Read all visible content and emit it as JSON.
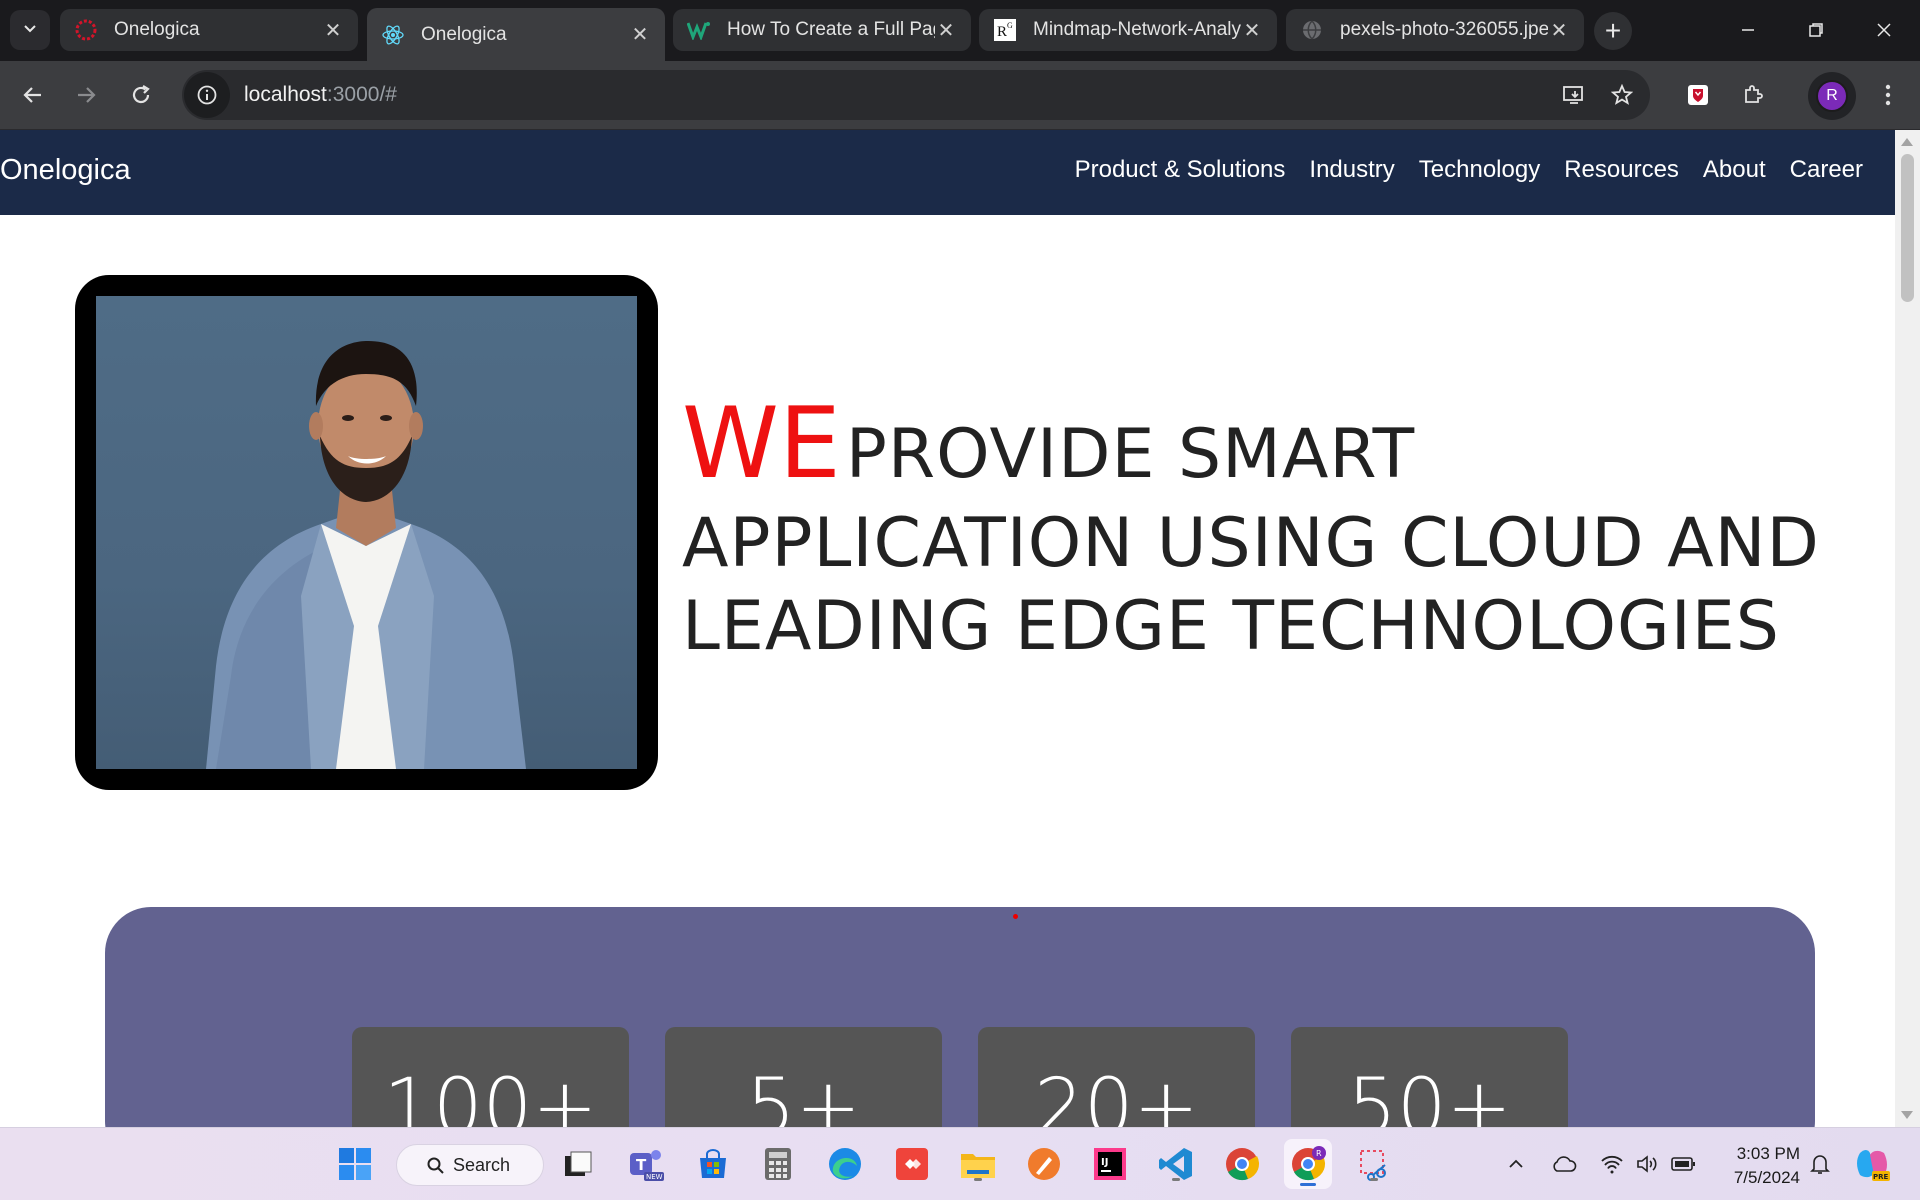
{
  "browser": {
    "tabs": [
      {
        "title": "Onelogica",
        "favicon": "onelogica-red-icon",
        "active": false
      },
      {
        "title": "Onelogica",
        "favicon": "react-icon",
        "active": true
      },
      {
        "title": "How To Create a Full Pag",
        "favicon": "w-icon",
        "active": false
      },
      {
        "title": "Mindmap-Network-Analy",
        "favicon": "researchgate-icon",
        "active": false
      },
      {
        "title": "pexels-photo-326055.jpe",
        "favicon": "globe-icon",
        "active": false
      }
    ],
    "url_host": "localhost",
    "url_rest": ":3000/#",
    "profile_initial": "R"
  },
  "site": {
    "brand": "Onelogica",
    "nav": [
      "Product & Solutions",
      "Industry",
      "Technology",
      "Resources",
      "About",
      "Career"
    ],
    "headline": {
      "we": "WE",
      "line1": "PROVIDE SMART",
      "line2": "APPLICATION USING CLOUD AND",
      "line3": "LEADING EDGE TECHNOLOGIES"
    },
    "stats": [
      "100+",
      "5+",
      "20+",
      "50+"
    ]
  },
  "taskbar": {
    "search_label": "Search",
    "time": "3:03 PM",
    "date": "7/5/2024"
  },
  "colors": {
    "nav_bg": "#1b2a48",
    "accent_red": "#ee1111",
    "stats_panel": "#626290",
    "stat_card": "#555555"
  }
}
